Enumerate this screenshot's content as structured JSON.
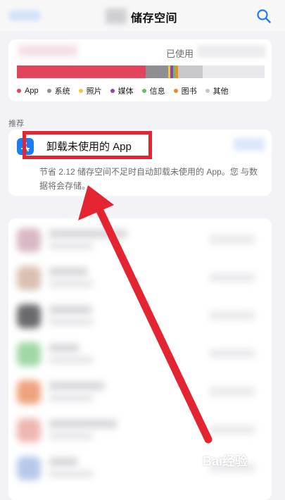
{
  "nav": {
    "title": "储存空间",
    "search_icon": "search-icon"
  },
  "storage": {
    "used_label": "已使用",
    "bar_segments": [
      {
        "name": "App",
        "color": "#e2445c",
        "fraction": 0.52
      },
      {
        "name": "系统",
        "color": "#8e8e93",
        "fraction": 0.09
      },
      {
        "name": "照片",
        "color": "#f4c542",
        "fraction": 0.01
      },
      {
        "name": "媒体",
        "color": "#8e44ad",
        "fraction": 0.01
      },
      {
        "name": "信息",
        "color": "#5bc26a",
        "fraction": 0.01
      },
      {
        "name": "图书",
        "color": "#ef8a2a",
        "fraction": 0.01
      },
      {
        "name": "其他",
        "color": "#c7c7cc",
        "fraction": 0.1
      }
    ],
    "legend": [
      {
        "label": "App",
        "color": "#e2445c"
      },
      {
        "label": "系统",
        "color": "#8e8e93"
      },
      {
        "label": "照片",
        "color": "#f4c542"
      },
      {
        "label": "媒体",
        "color": "#8e44ad"
      },
      {
        "label": "信息",
        "color": "#5bc26a"
      },
      {
        "label": "图书",
        "color": "#ef8a2a"
      },
      {
        "label": "其他",
        "color": "#c7c7cc"
      }
    ]
  },
  "recommendations": {
    "section_label": "推荐",
    "title": "卸载未使用的 App",
    "description": "节省 2.12 储存空间不足时自动卸载未使用的 App。您 与数据将会存储。",
    "app_icon": "app-store-icon"
  },
  "watermark": {
    "text": "Bai经验"
  },
  "colors": {
    "accent": "#1e7cf2",
    "annotation": "#e52432"
  }
}
